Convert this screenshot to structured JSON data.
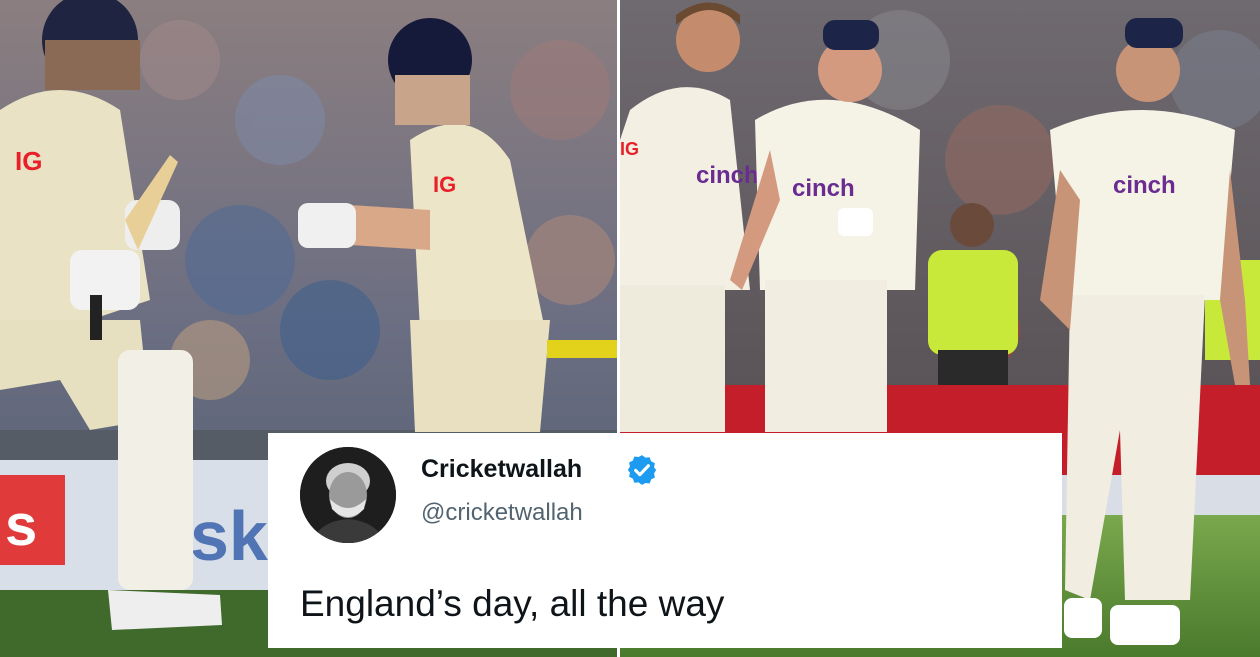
{
  "photos": {
    "left": {
      "description_icon": "batsmen-running-photo",
      "shirt_logo": "IG"
    },
    "right": {
      "description_icon": "bowlers-celebrating-photo",
      "shirt_sponsor": "cinch"
    }
  },
  "tweet": {
    "display_name": "Cricketwallah",
    "handle": "@cricketwallah",
    "text": "England’s day, all the way",
    "verified": true,
    "avatar_icon": "profile-photo-avatar",
    "verified_icon": "verified-badge-icon"
  },
  "colors": {
    "card_bg": "#ffffff",
    "name": "#0f1419",
    "handle": "#536471",
    "verified": "#1d9bf0",
    "cinch_purple": "#6a2c91",
    "ig_red": "#e8202a"
  }
}
